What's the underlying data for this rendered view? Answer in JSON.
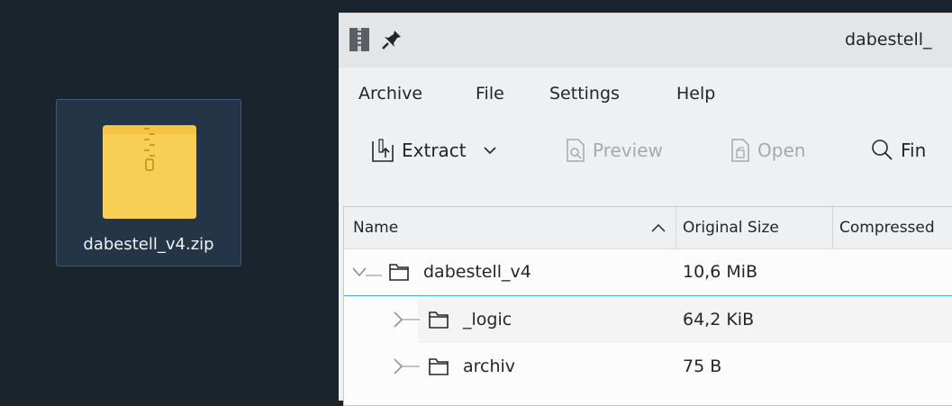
{
  "desktop": {
    "icon_label": "dabestell_v4.zip",
    "icon_name": "zip-archive-icon",
    "icon_color": "#f5c542"
  },
  "window": {
    "title": "dabestell_",
    "menu": [
      "Archive",
      "File",
      "Settings",
      "Help"
    ],
    "toolbar": {
      "extract": "Extract",
      "preview": "Preview",
      "open": "Open",
      "find": "Fin"
    },
    "columns": {
      "name": "Name",
      "original_size": "Original Size",
      "compressed": "Compressed"
    },
    "rows": [
      {
        "name": "dabestell_v4",
        "size": "10,6 MiB",
        "expanded": true
      },
      {
        "name": "_logic",
        "size": "64,2 KiB",
        "expanded": false
      },
      {
        "name": "archiv",
        "size": "75 B",
        "expanded": false
      }
    ],
    "accent_color": "#3daee9"
  }
}
